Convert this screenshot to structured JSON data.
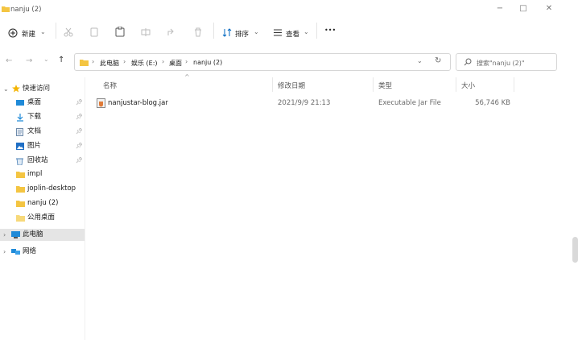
{
  "window": {
    "title": "nanju (2)",
    "minimize": "−",
    "maximize": "□",
    "close": "✕"
  },
  "toolbar": {
    "new_label": "新建",
    "sort_label": "排序",
    "view_label": "查看",
    "more_label": "•••"
  },
  "address": {
    "crumbs": [
      "此电脑",
      "娱乐 (E:)",
      "桌面",
      "nanju (2)"
    ],
    "search_placeholder": "搜索\"nanju (2)\""
  },
  "nav": {
    "quick_access": "快速访问",
    "items": [
      {
        "label": "桌面",
        "icon": "desktop-icon",
        "pinned": true
      },
      {
        "label": "下载",
        "icon": "download-icon",
        "pinned": true
      },
      {
        "label": "文档",
        "icon": "document-icon",
        "pinned": true
      },
      {
        "label": "图片",
        "icon": "pictures-icon",
        "pinned": true
      },
      {
        "label": "回收站",
        "icon": "recycle-bin-icon",
        "pinned": true
      },
      {
        "label": "impl",
        "icon": "folder-icon",
        "pinned": false
      },
      {
        "label": "joplin-desktop",
        "icon": "folder-icon",
        "pinned": false
      },
      {
        "label": "nanju (2)",
        "icon": "folder-icon",
        "pinned": false
      },
      {
        "label": "公用桌面",
        "icon": "folder-icon",
        "pinned": false
      }
    ],
    "this_pc": "此电脑",
    "network": "网络"
  },
  "columns": {
    "name": "名称",
    "modified": "修改日期",
    "type": "类型",
    "size": "大小"
  },
  "files": [
    {
      "name": "nanjustar-blog.jar",
      "modified": "2021/9/9 21:13",
      "type": "Executable Jar File",
      "size": "56,746 KB"
    }
  ],
  "colors": {
    "folder": "#f4c542",
    "accent": "#0067c0",
    "selected_bg": "#e5e5e5"
  }
}
